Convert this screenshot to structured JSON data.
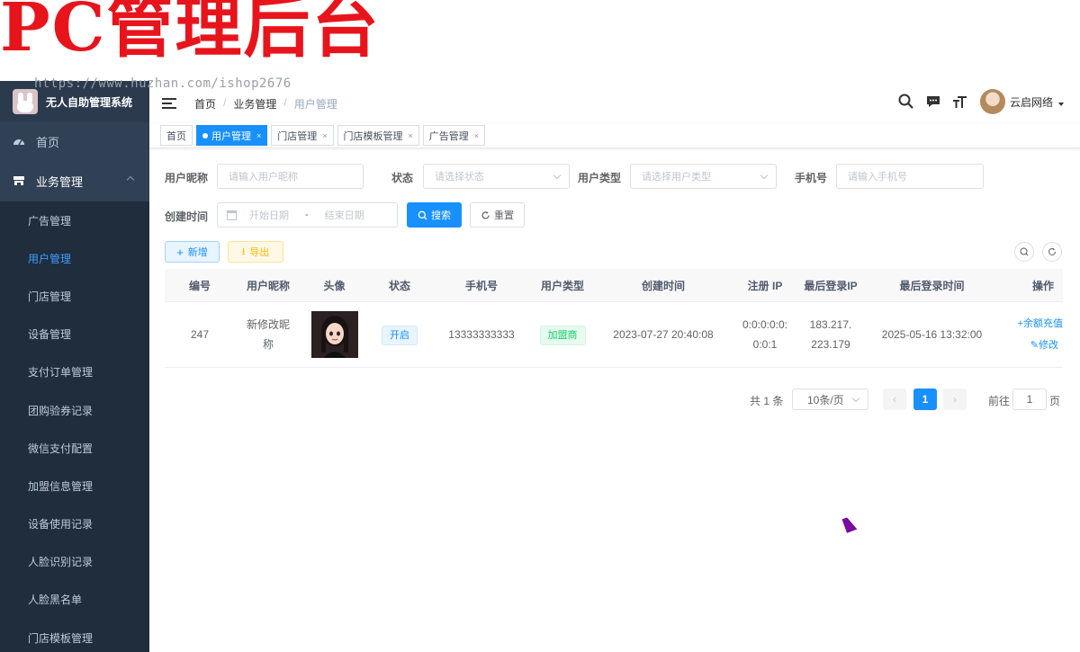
{
  "overlay": {
    "banner": "PC管理后台",
    "watermark": "https://www.huzhan.com/ishop2676"
  },
  "sidebar": {
    "app_title": "无人自助管理系统",
    "home_label": "首页",
    "group_label": "业务管理",
    "items": [
      {
        "label": "广告管理",
        "active": false
      },
      {
        "label": "用户管理",
        "active": true
      },
      {
        "label": "门店管理",
        "active": false
      },
      {
        "label": "设备管理",
        "active": false
      },
      {
        "label": "支付订单管理",
        "active": false
      },
      {
        "label": "团购验券记录",
        "active": false
      },
      {
        "label": "微信支付配置",
        "active": false
      },
      {
        "label": "加盟信息管理",
        "active": false
      },
      {
        "label": "设备使用记录",
        "active": false
      },
      {
        "label": "人脸识别记录",
        "active": false
      },
      {
        "label": "人脸黑名单",
        "active": false
      },
      {
        "label": "门店模板管理",
        "active": false
      }
    ]
  },
  "header": {
    "breadcrumb": [
      "首页",
      "业务管理",
      "用户管理"
    ],
    "user_name": "云启网络",
    "icons": [
      "search-icon",
      "message-icon",
      "font-size-icon"
    ]
  },
  "tags": [
    {
      "label": "首页",
      "active": false,
      "closable": false
    },
    {
      "label": "用户管理",
      "active": true,
      "closable": true
    },
    {
      "label": "门店管理",
      "active": false,
      "closable": true
    },
    {
      "label": "门店模板管理",
      "active": false,
      "closable": true
    },
    {
      "label": "广告管理",
      "active": false,
      "closable": true
    }
  ],
  "search": {
    "nickname_label": "用户昵称",
    "nickname_placeholder": "请输入用户昵称",
    "status_label": "状态",
    "status_placeholder": "请选择状态",
    "type_label": "用户类型",
    "type_placeholder": "请选择用户类型",
    "phone_label": "手机号",
    "phone_placeholder": "请输入手机号",
    "created_label": "创建时间",
    "start_placeholder": "开始日期",
    "range_sep": "-",
    "end_placeholder": "结束日期",
    "search_btn": "搜索",
    "reset_btn": "重置"
  },
  "toolbar": {
    "add_btn": "新增",
    "export_btn": "导出"
  },
  "table": {
    "columns": [
      "编号",
      "用户昵称",
      "头像",
      "状态",
      "手机号",
      "用户类型",
      "创建时间",
      "注册 IP",
      "最后登录IP",
      "最后登录时间",
      "操作"
    ],
    "rows": [
      {
        "id": "247",
        "nickname": "新修改昵称",
        "status": "开启",
        "phone": "13333333333",
        "user_type": "加盟商",
        "created": "2023-07-27 20:40:08",
        "reg_ip": "0:0:0:0:0:0:0:1",
        "last_ip": "183.217.223.179",
        "last_login": "2025-05-16 13:32:00",
        "action_recharge": "+余额充值",
        "action_edit": "修改"
      }
    ]
  },
  "pagination": {
    "total_text": "共 1 条",
    "page_size": "10条/页",
    "current_page": "1",
    "goto_label": "前往",
    "goto_value": "1",
    "page_suffix": "页"
  },
  "colors": {
    "primary": "#1890ff",
    "sidebar_bg": "#304156",
    "submenu_bg": "#1f2d3d",
    "banner_red": "#e8141c"
  }
}
